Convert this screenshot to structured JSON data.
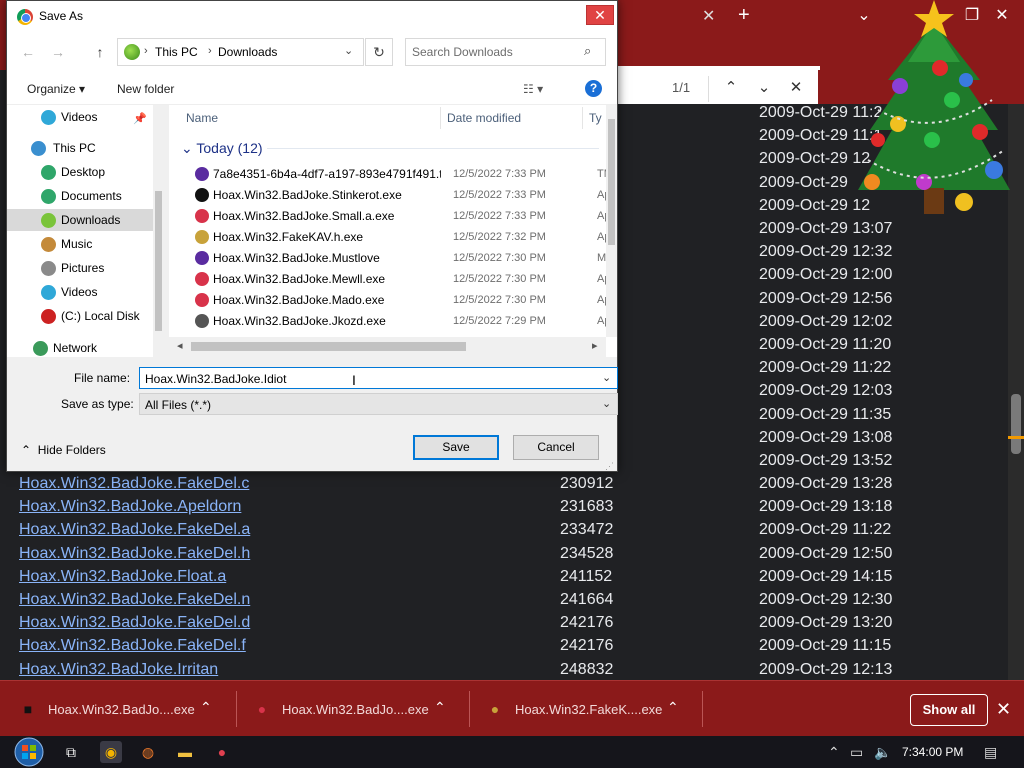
{
  "dialog": {
    "title": "Save As",
    "close": "✕",
    "nav": {
      "back": "←",
      "forward": "→",
      "up": "↑",
      "breadcrumb": [
        "This PC",
        "Downloads"
      ],
      "refresh": "↻",
      "search_placeholder": "Search Downloads"
    },
    "toolbar": {
      "organize": "Organize ▾",
      "new_folder": "New folder",
      "view": "☷ ▾",
      "help": "?"
    },
    "nav_pane": [
      {
        "label": "Videos",
        "icon": "videos-icon",
        "color": "#2fa8d8"
      },
      {
        "label": "This PC",
        "icon": "computer-icon",
        "color": "#3a8fcf"
      },
      {
        "label": "Desktop",
        "icon": "desktop-icon",
        "color": "#2fa66a"
      },
      {
        "label": "Documents",
        "icon": "documents-icon",
        "color": "#2fa66a"
      },
      {
        "label": "Downloads",
        "icon": "downloads-icon",
        "color": "#7ac43a"
      },
      {
        "label": "Music",
        "icon": "music-icon",
        "color": "#c48a3a"
      },
      {
        "label": "Pictures",
        "icon": "pictures-icon",
        "color": "#8a8a8a"
      },
      {
        "label": "Videos",
        "icon": "videos-icon",
        "color": "#2fa8d8"
      },
      {
        "label": "(C:) Local Disk",
        "icon": "disk-icon",
        "color": "#c22"
      },
      {
        "label": "Network",
        "icon": "network-icon",
        "color": "#3a9a5a"
      }
    ],
    "columns": {
      "name": "Name",
      "date": "Date modified",
      "type": "Ty"
    },
    "group": "Today (12)",
    "files": [
      {
        "name": "7a8e4351-6b4a-4df7-a197-893e4791f491.t...",
        "date": "12/5/2022 7:33 PM",
        "type": "TM",
        "color": "#5a2ca0"
      },
      {
        "name": "Hoax.Win32.BadJoke.Stinkerot.exe",
        "date": "12/5/2022 7:33 PM",
        "type": "Ap",
        "color": "#111111"
      },
      {
        "name": "Hoax.Win32.BadJoke.Small.a.exe",
        "date": "12/5/2022 7:33 PM",
        "type": "Ap",
        "color": "#d8334a"
      },
      {
        "name": "Hoax.Win32.FakeKAV.h.exe",
        "date": "12/5/2022 7:32 PM",
        "type": "Ap",
        "color": "#c8a23a"
      },
      {
        "name": "Hoax.Win32.BadJoke.Mustlove",
        "date": "12/5/2022 7:30 PM",
        "type": "M",
        "color": "#5a2ca0"
      },
      {
        "name": "Hoax.Win32.BadJoke.Mewll.exe",
        "date": "12/5/2022 7:30 PM",
        "type": "Ap",
        "color": "#d8334a"
      },
      {
        "name": "Hoax.Win32.BadJoke.Mado.exe",
        "date": "12/5/2022 7:30 PM",
        "type": "Ap",
        "color": "#d8334a"
      },
      {
        "name": "Hoax.Win32.BadJoke.Jkozd.exe",
        "date": "12/5/2022 7:29 PM",
        "type": "Ap",
        "color": "#555555"
      }
    ],
    "file_name_label": "File name:",
    "file_name_value": "Hoax.Win32.BadJoke.Idiot",
    "save_type_label": "Save as type:",
    "save_type_value": "All Files (*.*)",
    "hide_folders": "Hide Folders",
    "save": "Save",
    "cancel": "Cancel"
  },
  "browser": {
    "find_count": "1/1",
    "find_prev": "⌃",
    "find_next": "⌄",
    "find_close": "✕",
    "dates_top": [
      "2009-Oct-29 11:2",
      "2009-Oct-29 11:1",
      "2009-Oct-29 12",
      "2009-Oct-29",
      "2009-Oct-29 12",
      "2009-Oct-29 13:07",
      "2009-Oct-29 12:32",
      "2009-Oct-29 12:00",
      "2009-Oct-29 12:56",
      "2009-Oct-29 12:02",
      "2009-Oct-29 11:20",
      "2009-Oct-29 11:22",
      "2009-Oct-29 12:03",
      "2009-Oct-29 11:35",
      "2009-Oct-29 13:08",
      "2009-Oct-29 13:52"
    ],
    "rows": [
      {
        "name": "Hoax.Win32.BadJoke.FakeDel.c",
        "size": "230912",
        "date": "2009-Oct-29 13:28"
      },
      {
        "name": "Hoax.Win32.BadJoke.Apeldorn",
        "size": "231683",
        "date": "2009-Oct-29 13:18"
      },
      {
        "name": "Hoax.Win32.BadJoke.FakeDel.a",
        "size": "233472",
        "date": "2009-Oct-29 11:22"
      },
      {
        "name": "Hoax.Win32.BadJoke.FakeDel.h",
        "size": "234528",
        "date": "2009-Oct-29 12:50"
      },
      {
        "name": "Hoax.Win32.BadJoke.Float.a",
        "size": "241152",
        "date": "2009-Oct-29 14:15"
      },
      {
        "name": "Hoax.Win32.BadJoke.FakeDel.n",
        "size": "241664",
        "date": "2009-Oct-29 12:30"
      },
      {
        "name": "Hoax.Win32.BadJoke.FakeDel.d",
        "size": "242176",
        "date": "2009-Oct-29 13:20"
      },
      {
        "name": "Hoax.Win32.BadJoke.FakeDel.f",
        "size": "242176",
        "date": "2009-Oct-29 11:15"
      },
      {
        "name": "Hoax.Win32.BadJoke.Irritan",
        "size": "248832",
        "date": "2009-Oct-29 12:13"
      }
    ]
  },
  "downloads": {
    "items": [
      {
        "name": "Hoax.Win32.BadJo....exe",
        "icon": "stinkerot-icon",
        "color": "#111111"
      },
      {
        "name": "Hoax.Win32.BadJo....exe",
        "icon": "badjoke-icon",
        "color": "#d8334a"
      },
      {
        "name": "Hoax.Win32.FakeK....exe",
        "icon": "fakekav-icon",
        "color": "#c8a23a"
      }
    ],
    "show_all": "Show all",
    "close": "✕"
  },
  "taskbar": {
    "clock": "7:34:00 PM"
  }
}
